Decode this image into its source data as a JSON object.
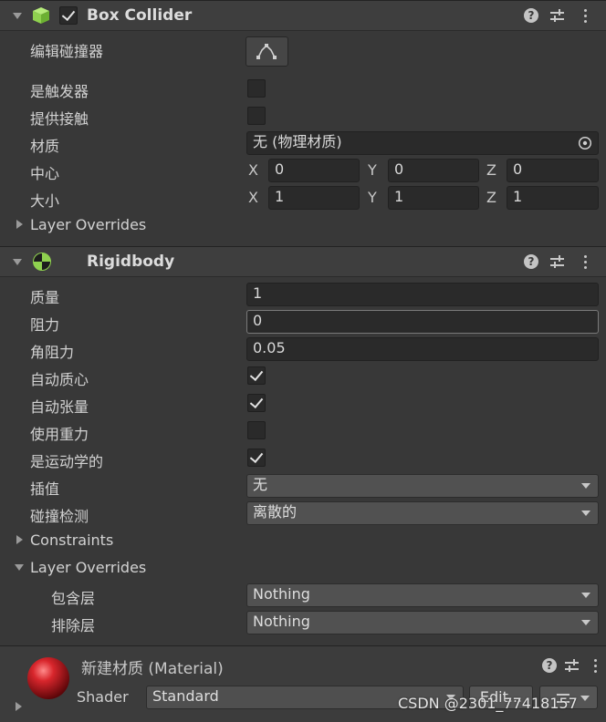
{
  "box_collider": {
    "title": "Box Collider",
    "enabled": true,
    "edit_collider_label": "编辑碰撞器",
    "is_trigger_label": "是触发器",
    "is_trigger": false,
    "provides_contacts_label": "提供接触",
    "provides_contacts": false,
    "material_label": "材质",
    "material_value": "无 (物理材质)",
    "center_label": "中心",
    "center": {
      "x_label": "X",
      "x": "0",
      "y_label": "Y",
      "y": "0",
      "z_label": "Z",
      "z": "0"
    },
    "size_label": "大小",
    "size": {
      "x_label": "X",
      "x": "1",
      "y_label": "Y",
      "y": "1",
      "z_label": "Z",
      "z": "1"
    },
    "layer_overrides_label": "Layer Overrides"
  },
  "rigidbody": {
    "title": "Rigidbody",
    "mass_label": "质量",
    "mass": "1",
    "drag_label": "阻力",
    "drag": "0",
    "angular_drag_label": "角阻力",
    "angular_drag": "0.05",
    "auto_center_label": "自动质心",
    "auto_center": true,
    "auto_tensor_label": "自动张量",
    "auto_tensor": true,
    "use_gravity_label": "使用重力",
    "use_gravity": false,
    "is_kinematic_label": "是运动学的",
    "is_kinematic": true,
    "interpolate_label": "插值",
    "interpolate": "无",
    "collision_detection_label": "碰撞检测",
    "collision_detection": "离散的",
    "constraints_label": "Constraints",
    "layer_overrides_label": "Layer Overrides",
    "include_layers_label": "包含层",
    "include_layers": "Nothing",
    "exclude_layers_label": "排除层",
    "exclude_layers": "Nothing"
  },
  "material": {
    "title": "新建材质 (Material)",
    "shader_label": "Shader",
    "shader_value": "Standard",
    "edit_label": "Edit..."
  },
  "watermark": "CSDN @2301_77418157",
  "colors": {
    "panel_bg": "#383838",
    "header_bg": "#3e3e3e",
    "field_bg": "#2a2a2a",
    "dropdown_bg": "#515151",
    "box_icon": "#8fd14f",
    "rigidbody_icon": "#8fd14f",
    "material_sphere": "#c0161c"
  },
  "icons": [
    "fold-arrow-icon",
    "box-collider-icon",
    "checkbox-icon",
    "help-icon",
    "presets-icon",
    "menu-kebab-icon",
    "edit-collider-icon",
    "object-picker-icon",
    "rigidbody-icon",
    "material-sphere-icon",
    "dropdown-arrow-icon"
  ]
}
